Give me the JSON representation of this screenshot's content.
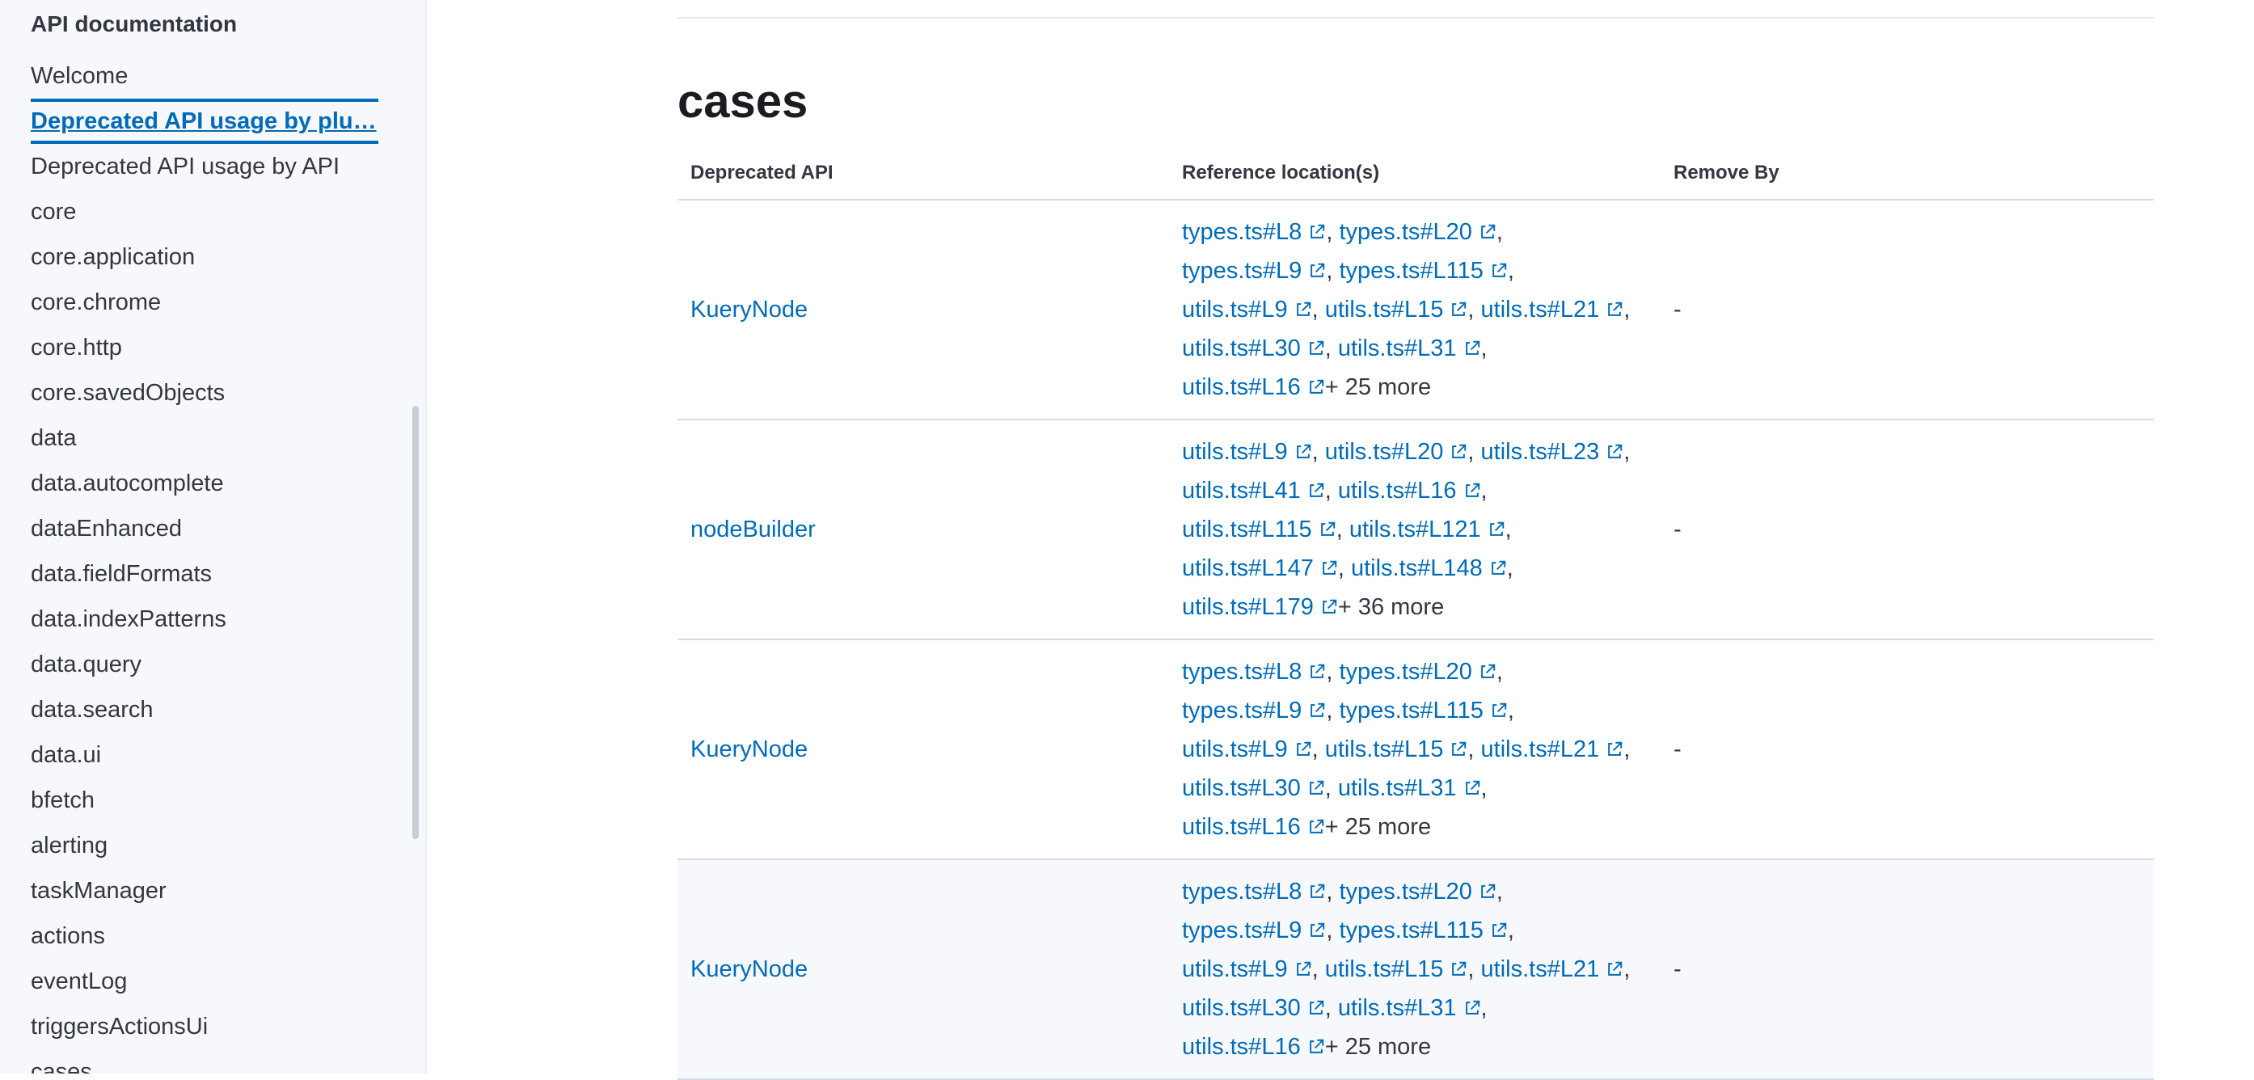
{
  "sidebar": {
    "heading": "API documentation",
    "items": [
      {
        "label": "Welcome",
        "active": false
      },
      {
        "label": "Deprecated API usage by plu…",
        "active": true
      },
      {
        "label": "Deprecated API usage by API",
        "active": false
      },
      {
        "label": "core",
        "active": false
      },
      {
        "label": "core.application",
        "active": false
      },
      {
        "label": "core.chrome",
        "active": false
      },
      {
        "label": "core.http",
        "active": false
      },
      {
        "label": "core.savedObjects",
        "active": false
      },
      {
        "label": "data",
        "active": false
      },
      {
        "label": "data.autocomplete",
        "active": false
      },
      {
        "label": "dataEnhanced",
        "active": false
      },
      {
        "label": "data.fieldFormats",
        "active": false
      },
      {
        "label": "data.indexPatterns",
        "active": false
      },
      {
        "label": "data.query",
        "active": false
      },
      {
        "label": "data.search",
        "active": false
      },
      {
        "label": "data.ui",
        "active": false
      },
      {
        "label": "bfetch",
        "active": false
      },
      {
        "label": "alerting",
        "active": false
      },
      {
        "label": "taskManager",
        "active": false
      },
      {
        "label": "actions",
        "active": false
      },
      {
        "label": "eventLog",
        "active": false
      },
      {
        "label": "triggersActionsUi",
        "active": false
      },
      {
        "label": "cases",
        "active": false
      }
    ]
  },
  "main": {
    "section_title": "cases",
    "columns": [
      "Deprecated API",
      "Reference location(s)",
      "Remove By"
    ],
    "rows": [
      {
        "api": "KueryNode",
        "refs": [
          "types.ts#L8",
          "types.ts#L20",
          "types.ts#L9",
          "types.ts#L115",
          "utils.ts#L9",
          "utils.ts#L15",
          "utils.ts#L21",
          "utils.ts#L30",
          "utils.ts#L31",
          "utils.ts#L16"
        ],
        "more": "+ 25 more",
        "remove_by": "-"
      },
      {
        "api": "nodeBuilder",
        "refs": [
          "utils.ts#L9",
          "utils.ts#L20",
          "utils.ts#L23",
          "utils.ts#L41",
          "utils.ts#L16",
          "utils.ts#L115",
          "utils.ts#L121",
          "utils.ts#L147",
          "utils.ts#L148",
          "utils.ts#L179"
        ],
        "more": "+ 36 more",
        "remove_by": "-"
      },
      {
        "api": "KueryNode",
        "refs": [
          "types.ts#L8",
          "types.ts#L20",
          "types.ts#L9",
          "types.ts#L115",
          "utils.ts#L9",
          "utils.ts#L15",
          "utils.ts#L21",
          "utils.ts#L30",
          "utils.ts#L31",
          "utils.ts#L16"
        ],
        "more": "+ 25 more",
        "remove_by": "-"
      },
      {
        "api": "KueryNode",
        "refs": [
          "types.ts#L8",
          "types.ts#L20",
          "types.ts#L9",
          "types.ts#L115",
          "utils.ts#L9",
          "utils.ts#L15",
          "utils.ts#L21",
          "utils.ts#L30",
          "utils.ts#L31",
          "utils.ts#L16"
        ],
        "more": "+ 25 more",
        "remove_by": "-"
      }
    ]
  },
  "icons": {
    "external_link": "external-link-icon"
  },
  "colors": {
    "link": "#006bb8",
    "active_nav": "#006bb8",
    "sidebar_bg": "#f7f8fc",
    "text": "#343741"
  }
}
